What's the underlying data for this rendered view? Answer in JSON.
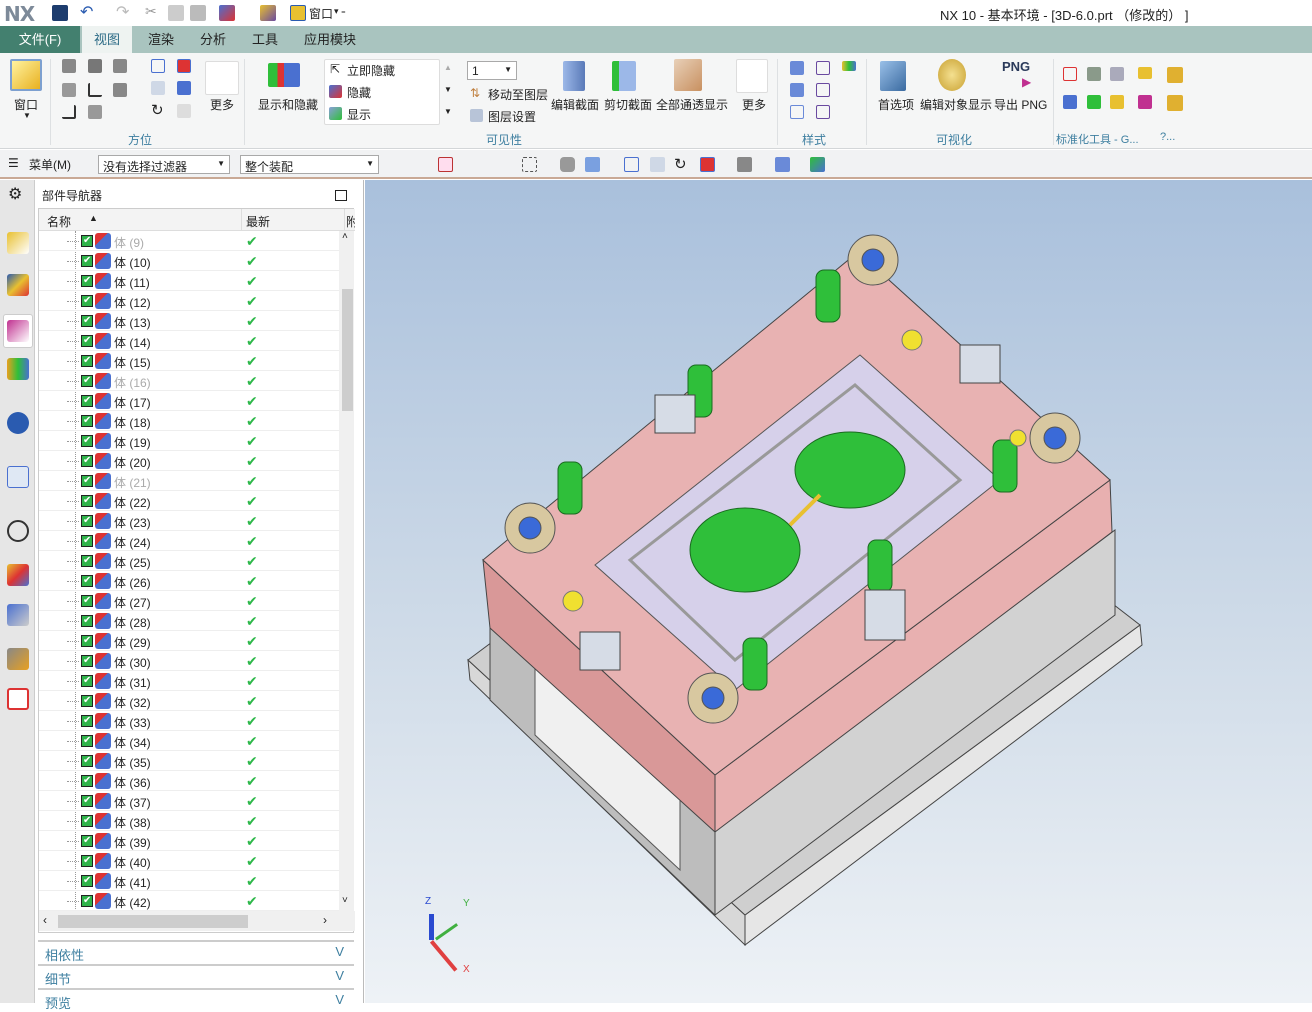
{
  "app": {
    "logo": "NX",
    "title": "NX 10 - 基本环境 - [3D-6.0.prt  （修改的）  ]",
    "quick_window_label": "窗口"
  },
  "tabs": [
    {
      "label": "文件(F)"
    },
    {
      "label": "视图",
      "active": true
    },
    {
      "label": "渲染"
    },
    {
      "label": "分析"
    },
    {
      "label": "工具"
    },
    {
      "label": "应用模块"
    }
  ],
  "ribbon": {
    "window": "窗口",
    "more1": "更多",
    "group_orient": "方位",
    "show_hide": "显示和隐藏",
    "hide_now": "立即隐藏",
    "hide": "隐藏",
    "show": "显示",
    "layer_value": "1",
    "move_to_layer": "移动至图层",
    "layer_settings": "图层设置",
    "edit_section": "编辑截面",
    "clip_section": "剪切截面",
    "all_transparent": "全部通透显示",
    "more2": "更多",
    "group_visibility": "可见性",
    "group_style": "样式",
    "preferences": "首选项",
    "edit_object_display": "编辑对象显示",
    "export_png": "导出 PNG",
    "png_badge": "PNG",
    "group_visualize": "可视化",
    "group_std_tools": "标准化工具 - G...",
    "group_extra": "?..."
  },
  "toolbar": {
    "menu": "菜单(M)",
    "filter": "没有选择过滤器",
    "scope": "整个装配"
  },
  "navigator": {
    "title": "部件导航器",
    "col_name": "名称",
    "col_latest": "最新",
    "col_more": "附",
    "items": [
      {
        "label": "体 (9)",
        "dim": true
      },
      {
        "label": "体 (10)"
      },
      {
        "label": "体 (11)"
      },
      {
        "label": "体 (12)"
      },
      {
        "label": "体 (13)"
      },
      {
        "label": "体 (14)"
      },
      {
        "label": "体 (15)"
      },
      {
        "label": "体 (16)",
        "dim": true
      },
      {
        "label": "体 (17)"
      },
      {
        "label": "体 (18)"
      },
      {
        "label": "体 (19)"
      },
      {
        "label": "体 (20)"
      },
      {
        "label": "体 (21)",
        "dim": true
      },
      {
        "label": "体 (22)"
      },
      {
        "label": "体 (23)"
      },
      {
        "label": "体 (24)"
      },
      {
        "label": "体 (25)"
      },
      {
        "label": "体 (26)"
      },
      {
        "label": "体 (27)"
      },
      {
        "label": "体 (28)"
      },
      {
        "label": "体 (29)"
      },
      {
        "label": "体 (30)"
      },
      {
        "label": "体 (31)"
      },
      {
        "label": "体 (32)"
      },
      {
        "label": "体 (33)"
      },
      {
        "label": "体 (34)"
      },
      {
        "label": "体 (35)"
      },
      {
        "label": "体 (36)"
      },
      {
        "label": "体 (37)"
      },
      {
        "label": "体 (38)"
      },
      {
        "label": "体 (39)"
      },
      {
        "label": "体 (40)"
      },
      {
        "label": "体 (41)"
      },
      {
        "label": "体 (42)"
      }
    ],
    "latest_mark": "✔",
    "sections": [
      "相依性",
      "细节",
      "预览"
    ]
  },
  "triad": {
    "x": "X",
    "y": "Y",
    "z": "Z"
  },
  "colors": {
    "file_tab": "#43806f",
    "tab_strip": "#a9c4bf",
    "accent": "#3e7fa0",
    "plate_pink": "#e4a6a6",
    "insert_green": "#2fbf3a",
    "viewport_top": "#a9c0dc"
  }
}
